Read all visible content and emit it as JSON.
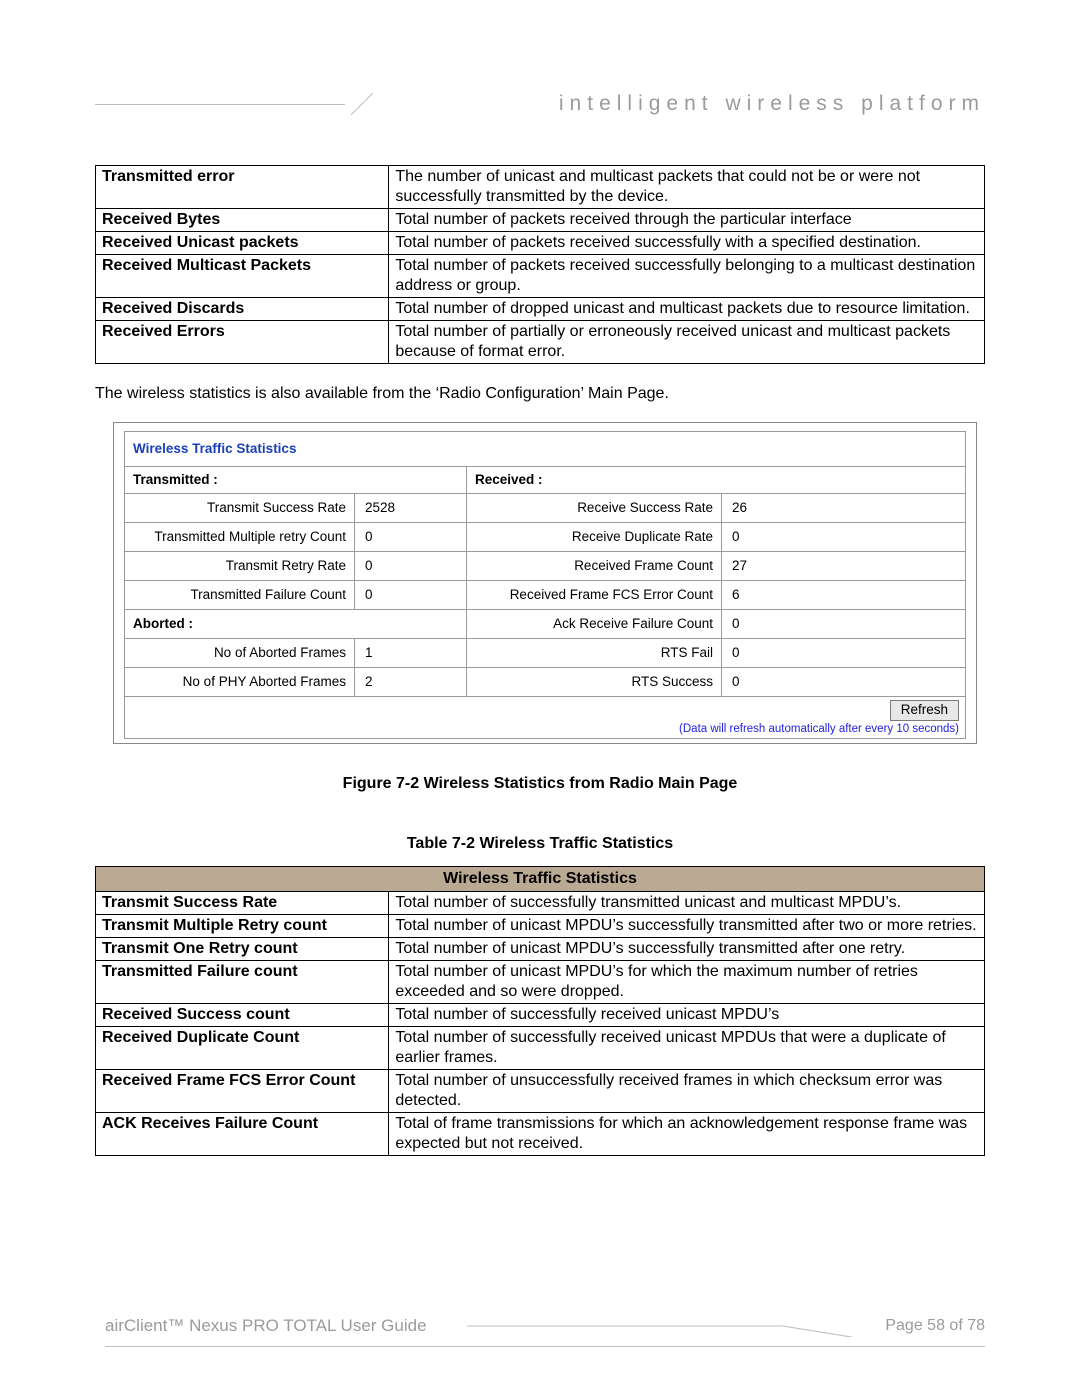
{
  "header": {
    "tagline": "intelligent wireless platform"
  },
  "table1": {
    "rows": [
      {
        "term": "Transmitted error",
        "desc": "The number of unicast and multicast packets that could not be or were not successfully transmitted by the device."
      },
      {
        "term": "Received Bytes",
        "desc": "Total number of packets received through the particular interface"
      },
      {
        "term": "Received Unicast packets",
        "desc": "Total number of packets received successfully with a specified destination."
      },
      {
        "term": "Received Multicast Packets",
        "desc": "Total number of packets received successfully belonging to a multicast destination address or group."
      },
      {
        "term": "Received Discards",
        "desc": "Total number of dropped unicast and multicast packets due to resource limitation."
      },
      {
        "term": "Received Errors",
        "desc": "Total number of partially or erroneously received unicast and multicast packets because of format error."
      }
    ]
  },
  "body_text": "The wireless statistics is also available from the ‘Radio Configuration’ Main Page.",
  "stats": {
    "title": "Wireless Traffic Statistics",
    "tx_header": "Transmitted :",
    "rx_header": "Received :",
    "ab_header": "Aborted :",
    "refresh_label": "Refresh",
    "refresh_note": "(Data will refresh automatically after every 10 seconds)",
    "rows": [
      {
        "l1": "Transmit Success Rate",
        "v1": "2528",
        "l2": "Receive Success Rate",
        "v2": "26"
      },
      {
        "l1": "Transmitted Multiple retry Count",
        "v1": "0",
        "l2": "Receive Duplicate Rate",
        "v2": "0"
      },
      {
        "l1": "Transmit Retry Rate",
        "v1": "0",
        "l2": "Received Frame Count",
        "v2": "27"
      },
      {
        "l1": "Transmitted Failure Count",
        "v1": "0",
        "l2": "Received Frame FCS Error Count",
        "v2": "6"
      },
      {
        "l1_hdr": true,
        "v1": "",
        "l2": "Ack Receive Failure Count",
        "v2": "0"
      },
      {
        "l1": "No of Aborted Frames",
        "v1": "1",
        "l2": "RTS Fail",
        "v2": "0"
      },
      {
        "l1": "No of PHY Aborted Frames",
        "v1": "2",
        "l2": "RTS Success",
        "v2": "0"
      }
    ]
  },
  "figure_caption": "Figure 7-2 Wireless Statistics from Radio Main Page",
  "table2_caption": "Table 7-2 Wireless Traffic Statistics",
  "table2": {
    "header": "Wireless Traffic Statistics",
    "rows": [
      {
        "term": "Transmit Success Rate",
        "desc": "Total number of successfully transmitted unicast and multicast MPDU’s."
      },
      {
        "term": "Transmit Multiple Retry count",
        "desc": "Total number of unicast MPDU’s successfully transmitted after two or more retries."
      },
      {
        "term": "Transmit One Retry count",
        "desc": "Total number of unicast MPDU’s successfully transmitted after one retry."
      },
      {
        "term": "Transmitted Failure count",
        "desc": "Total number of unicast MPDU’s for which the maximum number of retries exceeded and so were dropped."
      },
      {
        "term": "Received Success count",
        "desc": "Total number of successfully received unicast MPDU’s"
      },
      {
        "term": "Received Duplicate Count",
        "desc": "Total number of successfully received unicast MPDUs that were a duplicate of earlier frames."
      },
      {
        "term": "Received Frame FCS Error Count",
        "desc": "Total number of unsuccessfully received frames in which checksum error was detected."
      },
      {
        "term": "ACK Receives Failure Count",
        "desc": "Total of frame transmissions for which an acknowledgement response frame was expected but not received."
      }
    ]
  },
  "footer": {
    "product": "airClient™ Nexus PRO TOTAL User Guide",
    "page": "Page 58 of 78"
  }
}
